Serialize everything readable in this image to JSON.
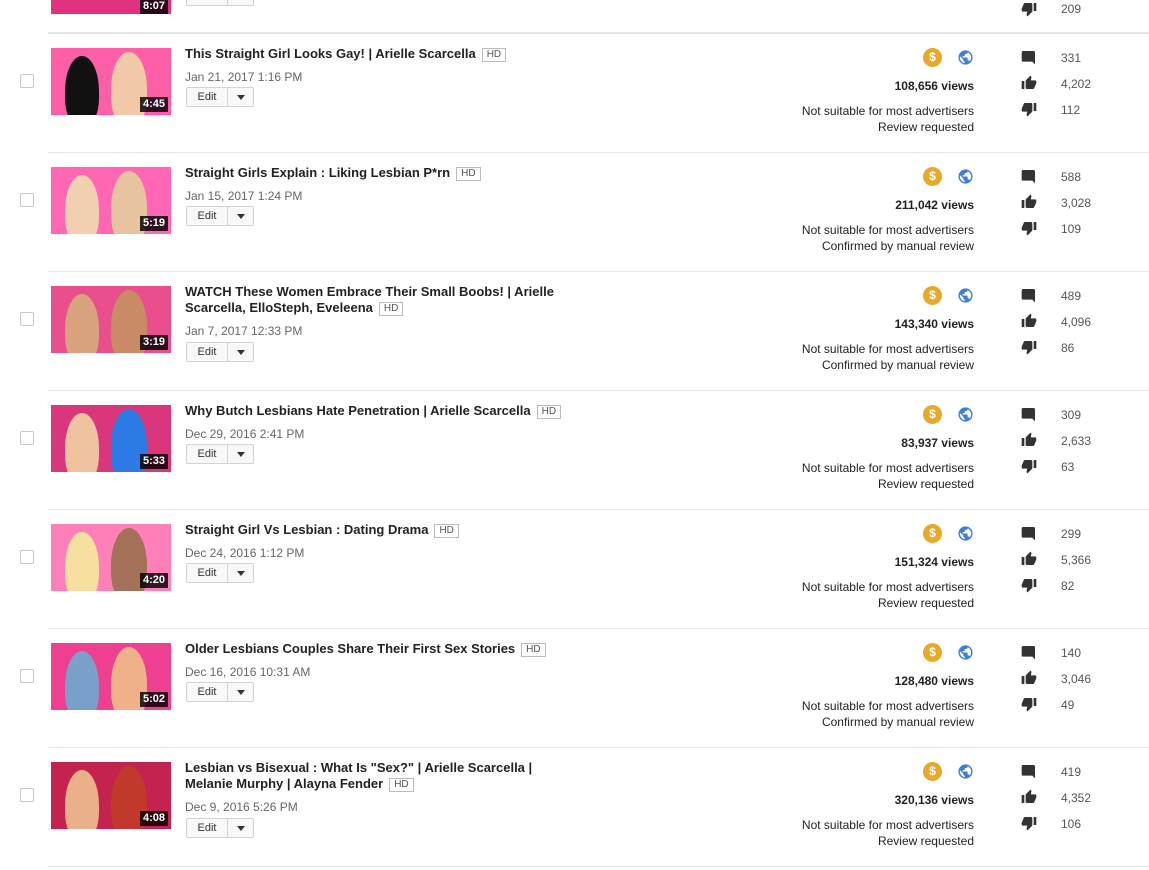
{
  "edit_label": "Edit",
  "hd_label": "HD",
  "top_partial": {
    "duration": "8:07",
    "dislikes": "209"
  },
  "videos": [
    {
      "title": "This Straight Girl Looks Gay! | Arielle Scarcella",
      "date": "Jan 21, 2017 1:16 PM",
      "duration": "4:45",
      "views": "108,656 views",
      "status1": "Not suitable for most advertisers",
      "status2": "Review requested",
      "comments": "331",
      "likes": "4,202",
      "dislikes": "112"
    },
    {
      "title": "Straight Girls Explain : Liking Lesbian P*rn",
      "date": "Jan 15, 2017 1:24 PM",
      "duration": "5:19",
      "views": "211,042 views",
      "status1": "Not suitable for most advertisers",
      "status2": "Confirmed by manual review",
      "comments": "588",
      "likes": "3,028",
      "dislikes": "109"
    },
    {
      "title": "WATCH These Women Embrace Their Small Boobs! | Arielle Scarcella, ElloSteph, Eveleena",
      "date": "Jan 7, 2017 12:33 PM",
      "duration": "3:19",
      "views": "143,340 views",
      "status1": "Not suitable for most advertisers",
      "status2": "Confirmed by manual review",
      "comments": "489",
      "likes": "4,096",
      "dislikes": "86"
    },
    {
      "title": "Why Butch Lesbians Hate Penetration | Arielle Scarcella",
      "date": "Dec 29, 2016 2:41 PM",
      "duration": "5:33",
      "views": "83,937 views",
      "status1": "Not suitable for most advertisers",
      "status2": "Review requested",
      "comments": "309",
      "likes": "2,633",
      "dislikes": "63"
    },
    {
      "title": "Straight Girl Vs Lesbian : Dating Drama",
      "date": "Dec 24, 2016 1:12 PM",
      "duration": "4:20",
      "views": "151,324 views",
      "status1": "Not suitable for most advertisers",
      "status2": "Review requested",
      "comments": "299",
      "likes": "5,366",
      "dislikes": "82"
    },
    {
      "title": "Older Lesbians Couples Share Their First Sex Stories",
      "date": "Dec 16, 2016 10:31 AM",
      "duration": "5:02",
      "views": "128,480 views",
      "status1": "Not suitable for most advertisers",
      "status2": "Confirmed by manual review",
      "comments": "140",
      "likes": "3,046",
      "dislikes": "49"
    },
    {
      "title": "Lesbian vs Bisexual : What Is \"Sex?\" | Arielle Scarcella | Melanie Murphy | Alayna Fender",
      "date": "Dec 9, 2016 5:26 PM",
      "duration": "4:08",
      "views": "320,136 views",
      "status1": "Not suitable for most advertisers",
      "status2": "Review requested",
      "comments": "419",
      "likes": "4,352",
      "dislikes": "106"
    }
  ],
  "colors": {
    "monetization": "#e8a82a",
    "globe": "#3d7fd6",
    "thumb_bg": "#e0327e"
  }
}
